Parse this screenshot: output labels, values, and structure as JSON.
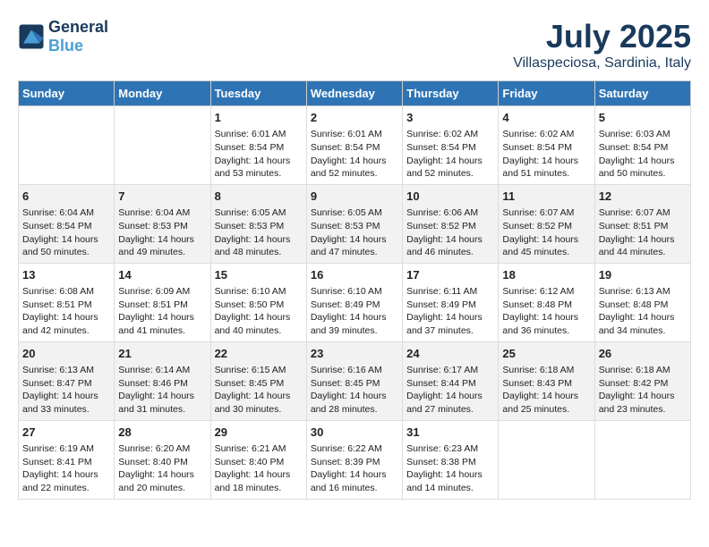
{
  "logo": {
    "line1": "General",
    "line2": "Blue"
  },
  "title": "July 2025",
  "subtitle": "Villaspeciosa, Sardinia, Italy",
  "headers": [
    "Sunday",
    "Monday",
    "Tuesday",
    "Wednesday",
    "Thursday",
    "Friday",
    "Saturday"
  ],
  "weeks": [
    [
      {
        "day": "",
        "sunrise": "",
        "sunset": "",
        "daylight": ""
      },
      {
        "day": "",
        "sunrise": "",
        "sunset": "",
        "daylight": ""
      },
      {
        "day": "1",
        "sunrise": "Sunrise: 6:01 AM",
        "sunset": "Sunset: 8:54 PM",
        "daylight": "Daylight: 14 hours and 53 minutes."
      },
      {
        "day": "2",
        "sunrise": "Sunrise: 6:01 AM",
        "sunset": "Sunset: 8:54 PM",
        "daylight": "Daylight: 14 hours and 52 minutes."
      },
      {
        "day": "3",
        "sunrise": "Sunrise: 6:02 AM",
        "sunset": "Sunset: 8:54 PM",
        "daylight": "Daylight: 14 hours and 52 minutes."
      },
      {
        "day": "4",
        "sunrise": "Sunrise: 6:02 AM",
        "sunset": "Sunset: 8:54 PM",
        "daylight": "Daylight: 14 hours and 51 minutes."
      },
      {
        "day": "5",
        "sunrise": "Sunrise: 6:03 AM",
        "sunset": "Sunset: 8:54 PM",
        "daylight": "Daylight: 14 hours and 50 minutes."
      }
    ],
    [
      {
        "day": "6",
        "sunrise": "Sunrise: 6:04 AM",
        "sunset": "Sunset: 8:54 PM",
        "daylight": "Daylight: 14 hours and 50 minutes."
      },
      {
        "day": "7",
        "sunrise": "Sunrise: 6:04 AM",
        "sunset": "Sunset: 8:53 PM",
        "daylight": "Daylight: 14 hours and 49 minutes."
      },
      {
        "day": "8",
        "sunrise": "Sunrise: 6:05 AM",
        "sunset": "Sunset: 8:53 PM",
        "daylight": "Daylight: 14 hours and 48 minutes."
      },
      {
        "day": "9",
        "sunrise": "Sunrise: 6:05 AM",
        "sunset": "Sunset: 8:53 PM",
        "daylight": "Daylight: 14 hours and 47 minutes."
      },
      {
        "day": "10",
        "sunrise": "Sunrise: 6:06 AM",
        "sunset": "Sunset: 8:52 PM",
        "daylight": "Daylight: 14 hours and 46 minutes."
      },
      {
        "day": "11",
        "sunrise": "Sunrise: 6:07 AM",
        "sunset": "Sunset: 8:52 PM",
        "daylight": "Daylight: 14 hours and 45 minutes."
      },
      {
        "day": "12",
        "sunrise": "Sunrise: 6:07 AM",
        "sunset": "Sunset: 8:51 PM",
        "daylight": "Daylight: 14 hours and 44 minutes."
      }
    ],
    [
      {
        "day": "13",
        "sunrise": "Sunrise: 6:08 AM",
        "sunset": "Sunset: 8:51 PM",
        "daylight": "Daylight: 14 hours and 42 minutes."
      },
      {
        "day": "14",
        "sunrise": "Sunrise: 6:09 AM",
        "sunset": "Sunset: 8:51 PM",
        "daylight": "Daylight: 14 hours and 41 minutes."
      },
      {
        "day": "15",
        "sunrise": "Sunrise: 6:10 AM",
        "sunset": "Sunset: 8:50 PM",
        "daylight": "Daylight: 14 hours and 40 minutes."
      },
      {
        "day": "16",
        "sunrise": "Sunrise: 6:10 AM",
        "sunset": "Sunset: 8:49 PM",
        "daylight": "Daylight: 14 hours and 39 minutes."
      },
      {
        "day": "17",
        "sunrise": "Sunrise: 6:11 AM",
        "sunset": "Sunset: 8:49 PM",
        "daylight": "Daylight: 14 hours and 37 minutes."
      },
      {
        "day": "18",
        "sunrise": "Sunrise: 6:12 AM",
        "sunset": "Sunset: 8:48 PM",
        "daylight": "Daylight: 14 hours and 36 minutes."
      },
      {
        "day": "19",
        "sunrise": "Sunrise: 6:13 AM",
        "sunset": "Sunset: 8:48 PM",
        "daylight": "Daylight: 14 hours and 34 minutes."
      }
    ],
    [
      {
        "day": "20",
        "sunrise": "Sunrise: 6:13 AM",
        "sunset": "Sunset: 8:47 PM",
        "daylight": "Daylight: 14 hours and 33 minutes."
      },
      {
        "day": "21",
        "sunrise": "Sunrise: 6:14 AM",
        "sunset": "Sunset: 8:46 PM",
        "daylight": "Daylight: 14 hours and 31 minutes."
      },
      {
        "day": "22",
        "sunrise": "Sunrise: 6:15 AM",
        "sunset": "Sunset: 8:45 PM",
        "daylight": "Daylight: 14 hours and 30 minutes."
      },
      {
        "day": "23",
        "sunrise": "Sunrise: 6:16 AM",
        "sunset": "Sunset: 8:45 PM",
        "daylight": "Daylight: 14 hours and 28 minutes."
      },
      {
        "day": "24",
        "sunrise": "Sunrise: 6:17 AM",
        "sunset": "Sunset: 8:44 PM",
        "daylight": "Daylight: 14 hours and 27 minutes."
      },
      {
        "day": "25",
        "sunrise": "Sunrise: 6:18 AM",
        "sunset": "Sunset: 8:43 PM",
        "daylight": "Daylight: 14 hours and 25 minutes."
      },
      {
        "day": "26",
        "sunrise": "Sunrise: 6:18 AM",
        "sunset": "Sunset: 8:42 PM",
        "daylight": "Daylight: 14 hours and 23 minutes."
      }
    ],
    [
      {
        "day": "27",
        "sunrise": "Sunrise: 6:19 AM",
        "sunset": "Sunset: 8:41 PM",
        "daylight": "Daylight: 14 hours and 22 minutes."
      },
      {
        "day": "28",
        "sunrise": "Sunrise: 6:20 AM",
        "sunset": "Sunset: 8:40 PM",
        "daylight": "Daylight: 14 hours and 20 minutes."
      },
      {
        "day": "29",
        "sunrise": "Sunrise: 6:21 AM",
        "sunset": "Sunset: 8:40 PM",
        "daylight": "Daylight: 14 hours and 18 minutes."
      },
      {
        "day": "30",
        "sunrise": "Sunrise: 6:22 AM",
        "sunset": "Sunset: 8:39 PM",
        "daylight": "Daylight: 14 hours and 16 minutes."
      },
      {
        "day": "31",
        "sunrise": "Sunrise: 6:23 AM",
        "sunset": "Sunset: 8:38 PM",
        "daylight": "Daylight: 14 hours and 14 minutes."
      },
      {
        "day": "",
        "sunrise": "",
        "sunset": "",
        "daylight": ""
      },
      {
        "day": "",
        "sunrise": "",
        "sunset": "",
        "daylight": ""
      }
    ]
  ]
}
